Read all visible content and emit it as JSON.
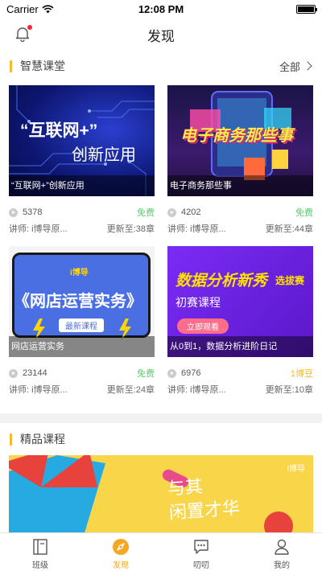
{
  "status": {
    "carrier": "Carrier",
    "time": "12:08 PM"
  },
  "nav": {
    "title": "发现"
  },
  "smart": {
    "name": "智慧课堂",
    "more": "全部",
    "cards": [
      {
        "caption": "“互联网+”创新应用",
        "views": "5378",
        "price": "免费",
        "teacher": "讲师: i博导原...",
        "update": "更新至:38章",
        "thumb_title": "“互联网+”",
        "thumb_sub": "创新应用"
      },
      {
        "caption": "电子商务那些事",
        "views": "4202",
        "price": "免费",
        "teacher": "讲师: i博导原...",
        "update": "更新至:44章",
        "thumb_title": "电子商务那些事"
      },
      {
        "caption": "网店运营实务",
        "views": "23144",
        "price": "免费",
        "teacher": "讲师: i博导原...",
        "update": "更新至:24章",
        "thumb_title": "《网店运营实务》",
        "thumb_sub": "最新课程",
        "thumb_logo": "i博导"
      },
      {
        "caption": "从0到1，数据分析进阶日记",
        "views": "6976",
        "price": "1博豆",
        "teacher": "讲师: i博导原...",
        "update": "更新至:10章",
        "thumb_title": "数据分析新秀",
        "thumb_tag": "选拔赛",
        "thumb_sub": "初赛课程",
        "thumb_btn": "立即观看"
      }
    ]
  },
  "premium": {
    "name": "精品课程",
    "banner_text_1": "与其",
    "banner_text_2": "闲置才华",
    "banner_logo": "i博导"
  },
  "tabs": [
    {
      "label": "班级",
      "icon": "book-icon"
    },
    {
      "label": "发现",
      "icon": "compass-icon"
    },
    {
      "label": "叨叨",
      "icon": "chat-icon"
    },
    {
      "label": "我的",
      "icon": "user-icon"
    }
  ],
  "colors": {
    "accent": "#f5b92e",
    "free": "#5ac870",
    "gold": "#f5b92e"
  }
}
